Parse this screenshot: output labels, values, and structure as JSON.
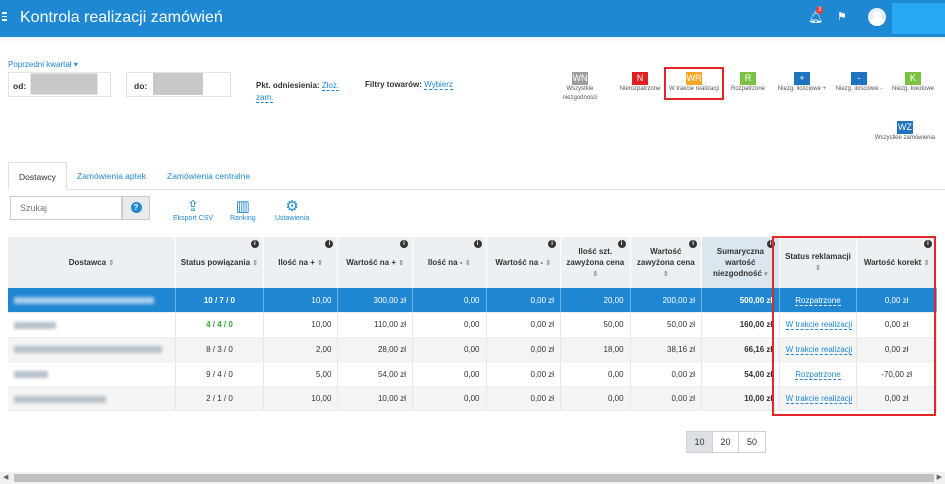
{
  "header": {
    "title": "Kontrola realizacji zamówień",
    "notification_count": "3"
  },
  "filters": {
    "period_link": "Poprzedni kwartał ▾",
    "date_from_label": "od:",
    "date_to_label": "do:",
    "ref_label": "Pkt. odniesienia:",
    "ref_value": "Złoż. zam.",
    "goods_label": "Filtry towarów:",
    "goods_value": "Wybierz"
  },
  "filter_buttons": [
    {
      "code": "WN",
      "label": "Wszystkie niezgodności",
      "color": "#9e9e9e"
    },
    {
      "code": "N",
      "label": "Nierozpatrzone",
      "color": "#e02020"
    },
    {
      "code": "WR",
      "label": "W trakcie realizacji",
      "color": "#f5a623"
    },
    {
      "code": "R",
      "label": "Rozpatrzone",
      "color": "#7cc242"
    },
    {
      "code": "+",
      "label": "Niezg. ilościowe +",
      "color": "#1e73be"
    },
    {
      "code": "-",
      "label": "Niezg. ilościowe -",
      "color": "#1e73be"
    },
    {
      "code": "K",
      "label": "Niezg. kwotowe",
      "color": "#7cc242"
    },
    {
      "code": "WZ",
      "label": "Wszystkie zamówienia",
      "color": "#1e73be"
    }
  ],
  "tabs": [
    "Dostawcy",
    "Zamówienia aptek",
    "Zamówienia centralne"
  ],
  "search": {
    "placeholder": "Szukaj"
  },
  "tools": [
    "Eksport CSV",
    "Ranking",
    "Ustawienia"
  ],
  "table": {
    "headers": [
      "Dostawca",
      "Status powiązania",
      "Ilość na +",
      "Wartość na +",
      "Ilość na -",
      "Wartość na -",
      "Ilość szt. zawyżona cena",
      "Wartość zawyżona cena",
      "Sumaryczna wartość niezgodność",
      "Status reklamacji",
      "Wartość korekt"
    ],
    "rows": [
      {
        "status": "10 / 7 / 0",
        "qty_plus": "10,00",
        "val_plus": "300,00 zł",
        "qty_minus": "0,00",
        "val_minus": "0,00 zł",
        "qty_price": "20,00",
        "val_price": "200,00 zł",
        "sum": "500,00 zł",
        "claim": "Rozpatrzone",
        "corr": "0,00 zł"
      },
      {
        "status": "4 / 4 / 0",
        "qty_plus": "10,00",
        "val_plus": "110,00 zł",
        "qty_minus": "0,00",
        "val_minus": "0,00 zł",
        "qty_price": "50,00",
        "val_price": "50,00 zł",
        "sum": "160,00 zł",
        "claim": "W trakcie realizacji",
        "corr": "0,00 zł"
      },
      {
        "status": "8 / 3 / 0",
        "qty_plus": "2,00",
        "val_plus": "28,00 zł",
        "qty_minus": "0,00",
        "val_minus": "0,00 zł",
        "qty_price": "18,00",
        "val_price": "38,16 zł",
        "sum": "66,16 zł",
        "claim": "W trakcie realizacji",
        "corr": "0,00 zł"
      },
      {
        "status": "9 / 4 / 0",
        "qty_plus": "5,00",
        "val_plus": "54,00 zł",
        "qty_minus": "0,00",
        "val_minus": "0,00 zł",
        "qty_price": "0,00",
        "val_price": "0,00 zł",
        "sum": "54,00 zł",
        "claim": "Rozpatrzone",
        "corr": "-70,00 zł"
      },
      {
        "status": "2 / 1 / 0",
        "qty_plus": "10,00",
        "val_plus": "10,00 zł",
        "qty_minus": "0,00",
        "val_minus": "0,00 zł",
        "qty_price": "0,00",
        "val_price": "0,00 zł",
        "sum": "10,00 zł",
        "claim": "W trakcie realizacji",
        "corr": "0,00 zł"
      }
    ]
  },
  "pager": [
    "10",
    "20",
    "50"
  ]
}
